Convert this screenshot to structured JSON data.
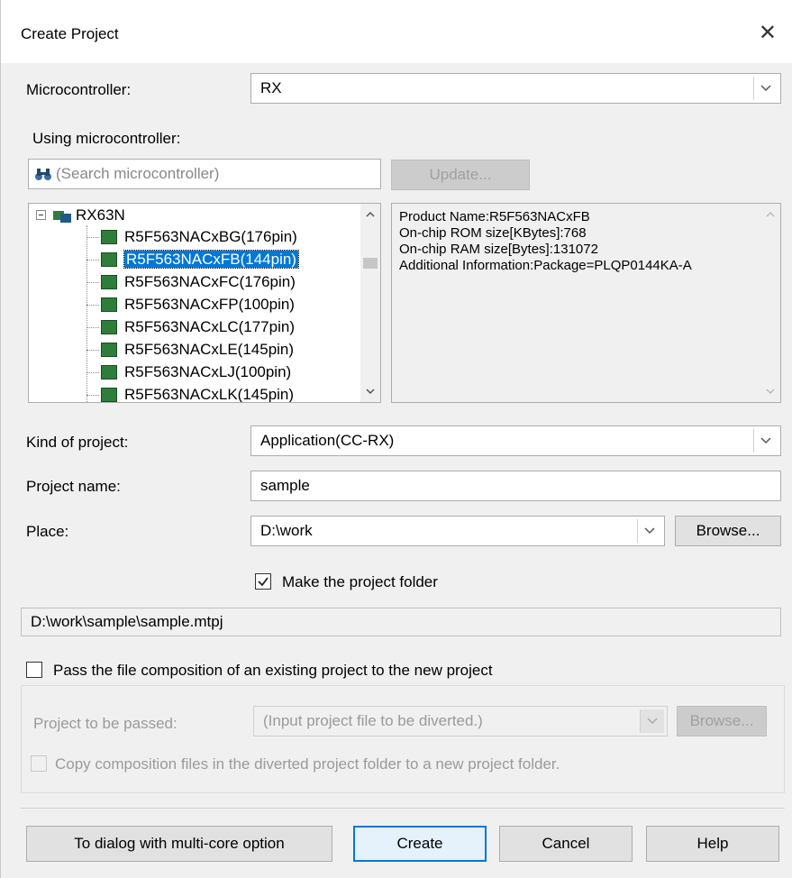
{
  "window": {
    "title": "Create Project",
    "close_glyph": "✕"
  },
  "microcontroller": {
    "label": "Microcontroller:",
    "value": "RX"
  },
  "using_microcontroller": {
    "label": "Using microcontroller:"
  },
  "search": {
    "placeholder": "(Search microcontroller)",
    "icon": "binoculars-icon"
  },
  "update_button": "Update...",
  "tree": {
    "root": "RX63N",
    "items": [
      "R5F563NACxBG(176pin)",
      "R5F563NACxFB(144pin)",
      "R5F563NACxFC(176pin)",
      "R5F563NACxFP(100pin)",
      "R5F563NACxLC(177pin)",
      "R5F563NACxLE(145pin)",
      "R5F563NACxLJ(100pin)",
      "R5F563NACxLK(145pin)"
    ],
    "selected_index": 1
  },
  "info": [
    "Product Name:R5F563NACxFB",
    "On-chip ROM size[KBytes]:768",
    "On-chip RAM size[Bytes]:131072",
    "Additional Information:Package=PLQP0144KA-A"
  ],
  "kind_of_project": {
    "label": "Kind of project:",
    "value": "Application(CC-RX)"
  },
  "project_name": {
    "label": "Project name:",
    "value": "sample"
  },
  "place": {
    "label": "Place:",
    "value": "D:\\work",
    "browse": "Browse..."
  },
  "make_folder": {
    "label": "Make the project folder",
    "checked": true
  },
  "project_path": "D:\\work\\sample\\sample.mtpj",
  "pass_composition": {
    "label": "Pass the file composition of an existing project to the new project",
    "checked": false
  },
  "project_to_be_passed": {
    "label": "Project to be passed:",
    "placeholder": "(Input project file to be diverted.)",
    "browse": "Browse..."
  },
  "copy_files": {
    "label": "Copy composition files in the diverted project folder to a new project folder.",
    "checked": false
  },
  "buttons": {
    "multicore": "To dialog with multi-core option",
    "create": "Create",
    "cancel": "Cancel",
    "help": "Help"
  }
}
